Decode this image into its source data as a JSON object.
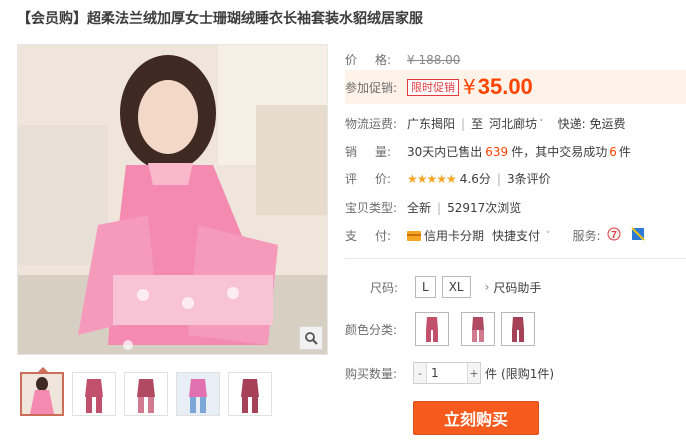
{
  "title": "【会员购】超柔法兰绒加厚女士珊瑚绒睡衣长袖套装水貂绒居家服",
  "price_row": {
    "label_a": "价",
    "label_b": "格:",
    "original": "¥ 188.00"
  },
  "promo_row": {
    "label": "参加促销:",
    "badge": "限时促销",
    "currency": "¥",
    "price": "35.00"
  },
  "shipping_row": {
    "label": "物流运费:",
    "from": "广东揭阳",
    "to_prefix": "至",
    "to": "河北廊坊",
    "courier": "快递: 免运费"
  },
  "sales_row": {
    "label_a": "销",
    "label_b": "量:",
    "prefix": "30天内已售出",
    "count": "639",
    "mid": "件，其中交易成功",
    "success": "6",
    "suffix": "件"
  },
  "rating_row": {
    "label_a": "评",
    "label_b": "价:",
    "stars": "★★★★★",
    "score": "4.6分",
    "reviews": "3条评价"
  },
  "type_row": {
    "label": "宝贝类型:",
    "condition": "全新",
    "views": "52917次浏览"
  },
  "pay_row": {
    "label_a": "支",
    "label_b": "付:",
    "credit": "信用卡分期",
    "quick": "快捷支付",
    "service_label": "服务:"
  },
  "size": {
    "label": "尺码:",
    "options": [
      "L",
      "XL"
    ],
    "guide": "尺码助手"
  },
  "color": {
    "label": "颜色分类:",
    "swatch_count": 3
  },
  "quantity": {
    "label": "购买数量:",
    "minus": "-",
    "value": "1",
    "plus": "+",
    "unit": "件",
    "limit": "(限购1件)"
  },
  "buy_button": "立刻购买",
  "colors": {
    "accent": "#ff4400",
    "buy_button": "#f65b1d",
    "promo_bg": "#fff2e8",
    "badge": "#e4393c",
    "pajama": "#f28bab",
    "stars": "#f5a623"
  },
  "icons": {
    "zoom": "magnifier-icon",
    "credit": "credit-card-icon",
    "service_1": "seven-day-return-icon",
    "service_2": "guarantee-icon"
  }
}
